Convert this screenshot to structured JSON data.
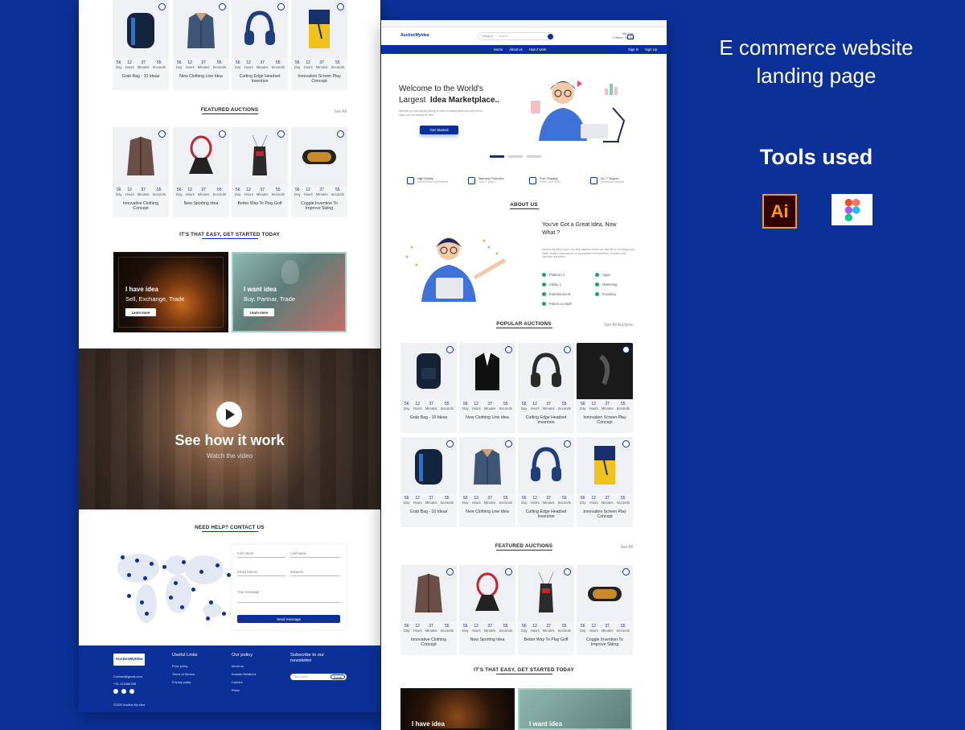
{
  "heading": {
    "line1": "E commerce website",
    "line2": "landing page",
    "tools": "Tools used"
  },
  "tool_icons": [
    {
      "label": "Ai",
      "icon": "illustrator-icon",
      "color": "#ff9a00"
    },
    {
      "label": "",
      "icon": "figma-icon",
      "color": "#ffffff"
    }
  ],
  "colors": {
    "brand": "#0b3199",
    "accent": "#0b3199",
    "check": "#22a06b"
  },
  "left": {
    "top_products": [
      {
        "name": "Grab Bag - 10 Ideas",
        "icon": "backpack"
      },
      {
        "name": "New Clothing Line Idea",
        "icon": "jacket"
      },
      {
        "name": "Cutting Edge Headset Invention",
        "icon": "headphones"
      },
      {
        "name": "Innovation Screen Play Concept",
        "icon": "book"
      }
    ],
    "countdown": [
      {
        "v": "56",
        "l": "Day"
      },
      {
        "v": "12",
        "l": "Hours"
      },
      {
        "v": "37",
        "l": "Minutes"
      },
      {
        "v": "55",
        "l": "Seconds"
      }
    ],
    "featured_title": "FEATURED AUCTIONS",
    "see_all": "See All",
    "featured": [
      {
        "name": "Innovative Clothing Concept",
        "icon": "coat"
      },
      {
        "name": "New Sporting Idea",
        "icon": "racket"
      },
      {
        "name": "Better Way To Play Golf",
        "icon": "golf"
      },
      {
        "name": "Coggle Invention To Improve Skiing",
        "icon": "goggles"
      }
    ],
    "easy_title": "IT'S THAT EASY, GET STARTED TODAY",
    "have_idea": {
      "title": "I have idea",
      "sub": "Sell, Exchange, Trade",
      "btn": "Learn more"
    },
    "want_idea": {
      "title": "I want idea",
      "sub": "Buy, Partnar, Trade",
      "btn": "Learn more"
    },
    "video": {
      "title": "See how it work",
      "sub": "Watch the video"
    },
    "contact_title": "NEED HELP? CONTACT US",
    "form": {
      "first": "First name",
      "last": "Last name",
      "email": "Email Adress",
      "subject": "Subjects",
      "message": "Your message",
      "send": "Send message"
    },
    "footer": {
      "logo": "AuctionMyIdea",
      "email": "Contact@gmail.com",
      "phone": "+91 123456789",
      "copyright": "©2020 Auction My Idea",
      "useful_title": "Useful Links",
      "useful": [
        "Price policy",
        "Terms of Service",
        "Privacy policy"
      ],
      "policy_title": "Our policy",
      "policy": [
        "About us",
        "Investor Relations",
        "Careers",
        "Press"
      ],
      "subscribe_title": "Subscribe to our newsletter",
      "subscribe_placeholder": "Enter email",
      "subscribe_btn": "Submit"
    }
  },
  "right": {
    "logo": "AuctionMyIdea",
    "search_placeholder": "Search",
    "search_category": "Category",
    "account": {
      "top": "My Cart",
      "bottom": "0 items - $0.00"
    },
    "nav": [
      "Home",
      "About us",
      "How it work"
    ],
    "auth": [
      "Sign In",
      "Sign Up"
    ],
    "hero": {
      "line1": "Welcome to the World's",
      "line2a": "Largest",
      "line2b": "Idea Marketplace..",
      "body": "Whether you are buying selling an idea or trading ideas you will find the ideas you are looking for here",
      "cta": "Get Started"
    },
    "features": [
      {
        "title": "High Quality",
        "sub": "Verified from top brands",
        "icon": "trophy-icon"
      },
      {
        "title": "Warranty Protection",
        "sub": "Over 2 years",
        "icon": "shield-check-icon"
      },
      {
        "title": "Free Shipping",
        "sub": "Order over $150",
        "icon": "truck-icon"
      },
      {
        "title": "24 / 7 Support",
        "sub": "Dedicated support",
        "icon": "support-icon"
      }
    ],
    "about": {
      "title": "ABOUT US",
      "heading1": "You've Got a Great Idea, Now",
      "heading2": "What ?",
      "body": "Auction My Idea is your one stop platform where you can sell or exchange your ideas, invest in innovations, bring together entrepreneurs, investors and inventors worldwide.",
      "list_left": [
        "Platform 1",
        "Ability 2",
        "Entertainment",
        "Patent on Stuff"
      ],
      "list_right": [
        "Apps",
        "Marketing",
        "Investing"
      ]
    },
    "popular_title": "POPULAR AUCTIONS",
    "see_all_auctions": "See All Auctions",
    "popular_row1": [
      {
        "name": "Grab Bag - 10 Ideas",
        "icon": "backpack2"
      },
      {
        "name": "New Clothing Line Idea",
        "icon": "suit"
      },
      {
        "name": "Cutting Edge Headset Invention",
        "icon": "headphones2"
      },
      {
        "name": "Innovation Screen Play Concept",
        "icon": "dark"
      }
    ],
    "popular_row2": [
      {
        "name": "Grab Bag - 10 Ideas",
        "icon": "backpack"
      },
      {
        "name": "New Clothing Line Idea",
        "icon": "jacket"
      },
      {
        "name": "Cutting Edge Headset Invention",
        "icon": "headphones"
      },
      {
        "name": "Innovation Screen Play Concept",
        "icon": "book"
      }
    ],
    "featured_title": "FEATURED AUCTIONS",
    "see_all": "See All",
    "featured": [
      {
        "name": "Innovative Clothing Concept",
        "icon": "coat"
      },
      {
        "name": "New Sporting Idea",
        "icon": "racket"
      },
      {
        "name": "Better Way To Play Golf",
        "icon": "golf"
      },
      {
        "name": "Coggle Invention To Improve Skiing",
        "icon": "goggles"
      }
    ],
    "easy_title": "IT'S THAT EASY, GET STARTED TODAY",
    "have_idea": "I have idea",
    "want_idea": "I want idea"
  }
}
